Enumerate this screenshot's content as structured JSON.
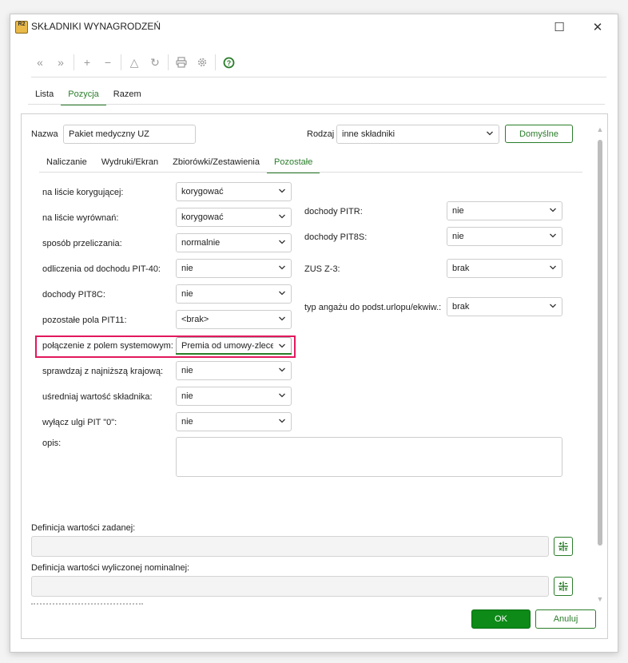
{
  "window": {
    "title": "SKŁADNIKI WYNAGRODZEŃ",
    "app_icon_text": "R2",
    "maximize_glyph": "☐",
    "close_glyph": "✕"
  },
  "toolbar": {
    "first_glyph": "«",
    "prev_glyph": "»",
    "add_glyph": "+",
    "remove_glyph": "−",
    "up_glyph": "△",
    "refresh_glyph": "↻",
    "print_icon": "printer-icon",
    "settings_icon": "gear-icon",
    "help_icon": "help-icon"
  },
  "main_tabs": [
    "Lista",
    "Pozycja",
    "Razem"
  ],
  "header": {
    "name_label": "Nazwa",
    "name_value": "Pakiet medyczny UZ",
    "kind_label": "Rodzaj",
    "kind_value": "inne składniki",
    "defaults_label": "Domyślne"
  },
  "sub_tabs": [
    "Naliczanie",
    "Wydruki/Ekran",
    "Zbiorówki/Zestawienia",
    "Pozostałe"
  ],
  "left_fields": [
    {
      "label": "na liście korygującej:",
      "value": "korygować"
    },
    {
      "label": "na liście wyrównań:",
      "value": "korygować"
    },
    {
      "label": "sposób przeliczania:",
      "value": "normalnie"
    },
    {
      "label": "odliczenia od dochodu PIT-40:",
      "value": "nie"
    },
    {
      "label": "dochody PIT8C:",
      "value": "nie"
    },
    {
      "label": "pozostałe pola PIT11:",
      "value": "<brak>"
    },
    {
      "label": "połączenie z polem systemowym:",
      "value": "Premia od umowy-zlecenia"
    },
    {
      "label": "sprawdzaj z najniższą krajową:",
      "value": "nie"
    },
    {
      "label": "uśredniaj wartość składnika:",
      "value": "nie"
    },
    {
      "label": "wyłącz ulgi PIT \"0\":",
      "value": "nie"
    }
  ],
  "right_fields": [
    {
      "label": "dochody PITR:",
      "value": "nie"
    },
    {
      "label": "dochody PIT8S:",
      "value": "nie"
    },
    {
      "label": "ZUS Z-3:",
      "value": "brak"
    },
    {
      "label": "typ angażu do podst.urlopu/ekwiw.:",
      "value": "brak"
    }
  ],
  "description": {
    "label": "opis:",
    "value": ""
  },
  "definitions": [
    {
      "label": "Definicja wartości zadanej:",
      "value": ""
    },
    {
      "label": "Definicja wartości wyliczonej nominalnej:",
      "value": ""
    }
  ],
  "footer": {
    "ok_label": "OK",
    "cancel_label": "Anuluj"
  },
  "colors": {
    "accent": "#2a7d2a",
    "primary_button": "#0d8a17",
    "highlight": "#e2185d"
  }
}
